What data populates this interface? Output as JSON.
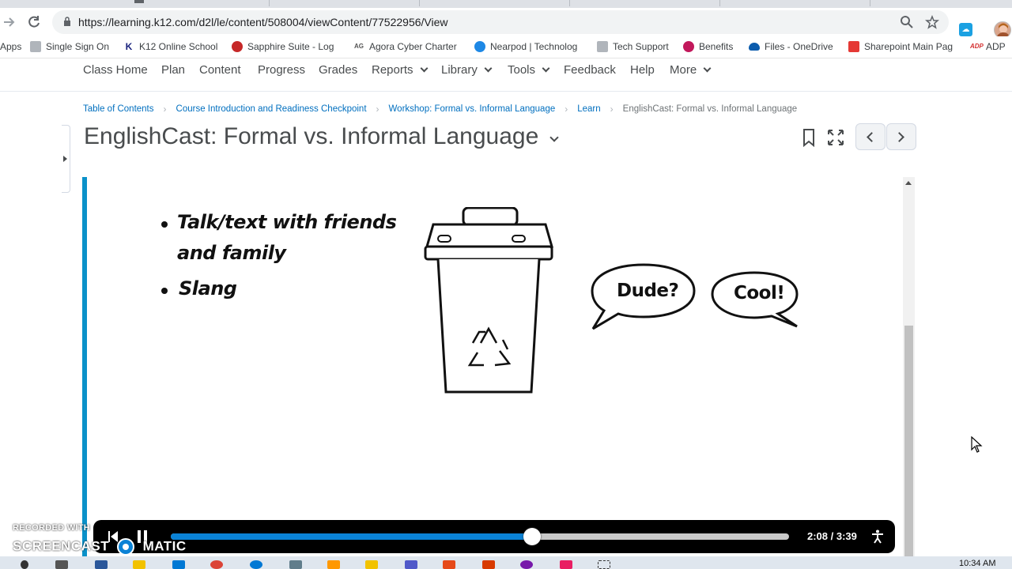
{
  "browser": {
    "url": "https://learning.k12.com/d2l/le/content/508004/viewContent/77522956/View"
  },
  "bookmarks": [
    {
      "label": "Apps",
      "color": "#5f6368"
    },
    {
      "label": "Single Sign On",
      "color": "#9aa0a6"
    },
    {
      "label": "K12 Online School",
      "color": "#1a237e"
    },
    {
      "label": "Sapphire Suite - Logo",
      "color": "#c62828"
    },
    {
      "label": "Agora Cyber Charter",
      "color": "#555555"
    },
    {
      "label": "Nearpod | Technolog",
      "color": "#1e88e5"
    },
    {
      "label": "Tech Support",
      "color": "#9aa0a6"
    },
    {
      "label": "Benefits",
      "color": "#c2185b"
    },
    {
      "label": "Files - OneDrive",
      "color": "#0b5cad"
    },
    {
      "label": "Sharepoint Main Pag",
      "color": "#e53935"
    },
    {
      "label": "ADP",
      "color": "#d32f2f"
    }
  ],
  "course_nav": {
    "items": [
      {
        "label": "Class Home",
        "dropdown": false
      },
      {
        "label": "Plan",
        "dropdown": false
      },
      {
        "label": "Content",
        "dropdown": false
      },
      {
        "label": "Progress",
        "dropdown": false
      },
      {
        "label": "Grades",
        "dropdown": false
      },
      {
        "label": "Reports",
        "dropdown": true
      },
      {
        "label": "Library",
        "dropdown": true
      },
      {
        "label": "Tools",
        "dropdown": true
      },
      {
        "label": "Feedback",
        "dropdown": false
      },
      {
        "label": "Help",
        "dropdown": false
      },
      {
        "label": "More",
        "dropdown": true
      }
    ]
  },
  "breadcrumbs": [
    "Table of Contents",
    "Course Introduction and Readiness Checkpoint",
    "Workshop: Formal vs. Informal Language",
    "Learn",
    "EnglishCast: Formal vs. Informal Language"
  ],
  "page": {
    "title": "EnglishCast: Formal vs. Informal Language"
  },
  "slide": {
    "bullets": [
      "Talk/text with friends",
      "and family",
      "Slang"
    ],
    "bubbles": [
      "Dude?",
      "Cool!"
    ]
  },
  "player": {
    "time": "2:08 / 3:39",
    "progress": 0.585,
    "watermark_top": "RECORDED WITH",
    "watermark_bottom": "SCREENCAST",
    "watermark_suffix": "MATIC"
  },
  "taskbar": {
    "clock": "10:34 AM"
  },
  "colors": {
    "accent": "#0a91c9",
    "link": "#006fbf",
    "progress": "#0a82d6"
  }
}
